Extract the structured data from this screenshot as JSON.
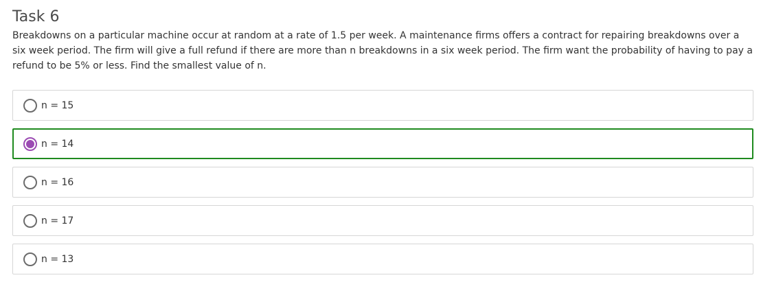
{
  "task": {
    "title": "Task 6",
    "question": "Breakdowns on a particular machine occur at random at a rate of 1.5 per week. A maintenance firms offers a contract for repairing breakdowns over a six week period. The firm will give a full refund if there are more than n breakdowns in a six week period. The firm want the probability of having to pay a refund to be 5% or less. Find the smallest value of n."
  },
  "options": [
    {
      "label": "n = 15",
      "selected": false
    },
    {
      "label": "n = 14",
      "selected": true
    },
    {
      "label": "n = 16",
      "selected": false
    },
    {
      "label": "n = 17",
      "selected": false
    },
    {
      "label": "n = 13",
      "selected": false
    }
  ],
  "colors": {
    "selected_border": "#1e8a1e",
    "radio_checked": "#9b4ab3",
    "option_border": "#d6d6d6"
  }
}
